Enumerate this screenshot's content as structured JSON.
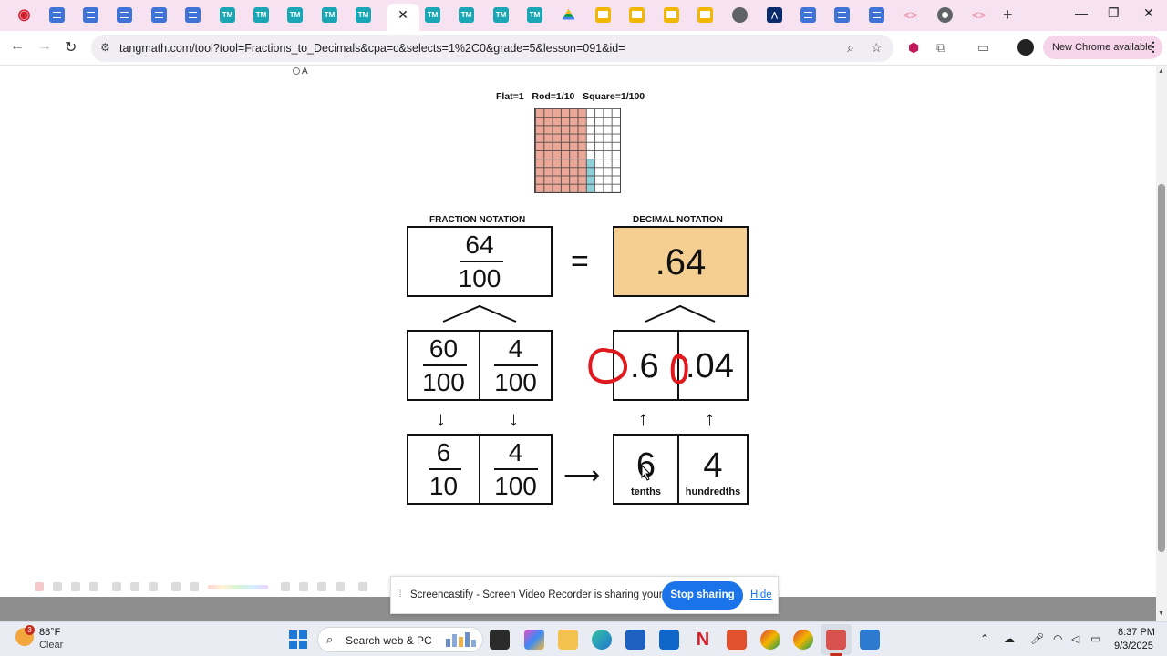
{
  "browser": {
    "url": "tangmath.com/tool?tool=Fractions_to_Decimals&cpa=c&selects=1%2C0&grade=5&lesson=091&id=",
    "update_button": "New Chrome available",
    "tab_marks": {
      "tm": "TM"
    }
  },
  "page": {
    "radio_label": "A",
    "legend": "Flat=1   Rod=1/10   Square=1/100",
    "fraction_heading": "FRACTION NOTATION",
    "decimal_heading": "DECIMAL NOTATION",
    "main_fraction": {
      "numerator": "64",
      "denominator": "100"
    },
    "equals": "=",
    "main_decimal": ".64",
    "split_fractions": [
      {
        "numerator": "60",
        "denominator": "100"
      },
      {
        "numerator": "4",
        "denominator": "100"
      }
    ],
    "split_decimals": [
      ".6",
      ".04"
    ],
    "simplified_fractions": [
      {
        "numerator": "6",
        "denominator": "10"
      },
      {
        "numerator": "4",
        "denominator": "100"
      }
    ],
    "place_values": [
      {
        "digit": "6",
        "label": "tenths"
      },
      {
        "digit": "4",
        "label": "hundredths"
      }
    ],
    "base_ten_model": {
      "total_squares": 100,
      "rods": 6,
      "squares": 4
    }
  },
  "screencastify": {
    "message": "Screencastify - Screen Video Recorder is sharing your screen.",
    "stop_label": "Stop sharing",
    "hide_label": "Hide"
  },
  "taskbar": {
    "temperature": "88°F",
    "condition": "Clear",
    "weather_badge": "3",
    "search_placeholder": "Search web & PC",
    "time": "8:37 PM",
    "date": "9/3/2025"
  },
  "colors": {
    "flat_fill": "#eba898",
    "square_fill": "#8fcfd6",
    "decimal_box": "#f5cf91",
    "annotation": "#e0191f",
    "accent_blue": "#1a73e8"
  }
}
